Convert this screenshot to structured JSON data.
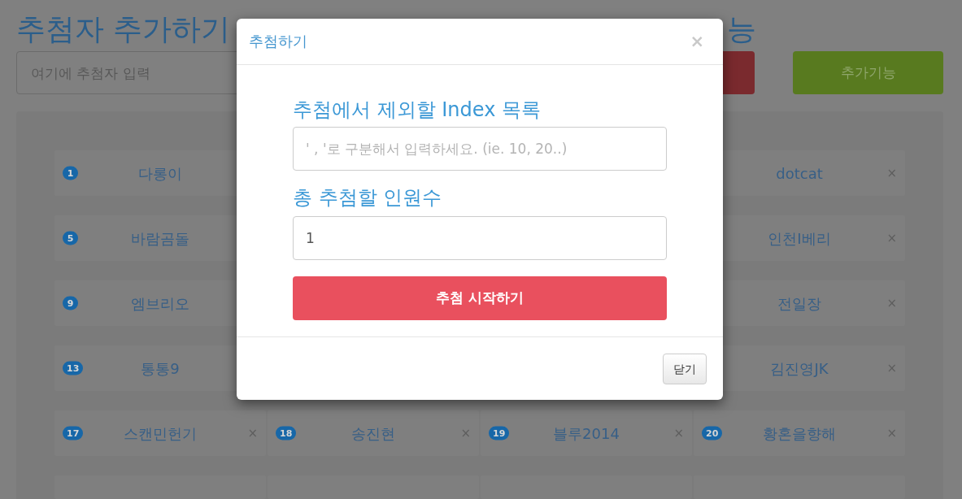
{
  "header": {
    "title": "추첨자 추가하기",
    "side_title": "능"
  },
  "entry_form": {
    "name_input": {
      "placeholder": "여기에 추첨자 입력"
    },
    "extra_button": "추가기능"
  },
  "entry_rows": [
    {
      "left": [
        {
          "kind": "entry",
          "number": "1",
          "name": "다롱이"
        }
      ],
      "right": [
        {
          "kind": "entry",
          "name": "dotcat",
          "remove": "×"
        }
      ]
    },
    {
      "left": [
        {
          "kind": "entry",
          "number": "5",
          "name": "바람곰돌"
        }
      ],
      "right": [
        {
          "kind": "entry",
          "name": "인천I베리",
          "remove": "×"
        }
      ]
    },
    {
      "left": [
        {
          "kind": "entry",
          "number": "9",
          "name": "엠브리오"
        }
      ],
      "right": [
        {
          "kind": "entry",
          "name": "전일장",
          "remove": "×"
        }
      ]
    },
    {
      "left": [
        {
          "kind": "entry",
          "number": "13",
          "name": "통통9"
        }
      ],
      "right": [
        {
          "kind": "entry",
          "name": "김진영JK",
          "remove": "×"
        }
      ]
    },
    {
      "left": [
        {
          "kind": "entry",
          "number": "17",
          "name": "스캔민헌기",
          "remove": "×"
        },
        {
          "kind": "entry",
          "number": "18",
          "name": "송진현",
          "remove": "×"
        }
      ],
      "right": [
        {
          "kind": "entry",
          "number": "19",
          "name": "블루2014",
          "remove": "×"
        },
        {
          "kind": "entry",
          "number": "20",
          "name": "황혼을향해",
          "remove": "×"
        }
      ]
    },
    {
      "left": [
        {
          "kind": "cut_off"
        },
        {
          "kind": "cut_off"
        }
      ],
      "right": [
        {
          "kind": "cut_off"
        },
        {
          "kind": "cut_off"
        }
      ]
    }
  ],
  "dialog": {
    "title": "추첨하기",
    "close": "×",
    "exclude_label": "추첨에서 제외할 Index 목록",
    "exclude_input": {
      "placeholder": "' , '로 구분해서 입력하세요. (ie. 10, 20..)"
    },
    "count_label": "총 추첨할 인원수",
    "count_input": {
      "value": "1"
    },
    "start_button": "추첨 시작하기",
    "dismiss_button": "닫기"
  }
}
